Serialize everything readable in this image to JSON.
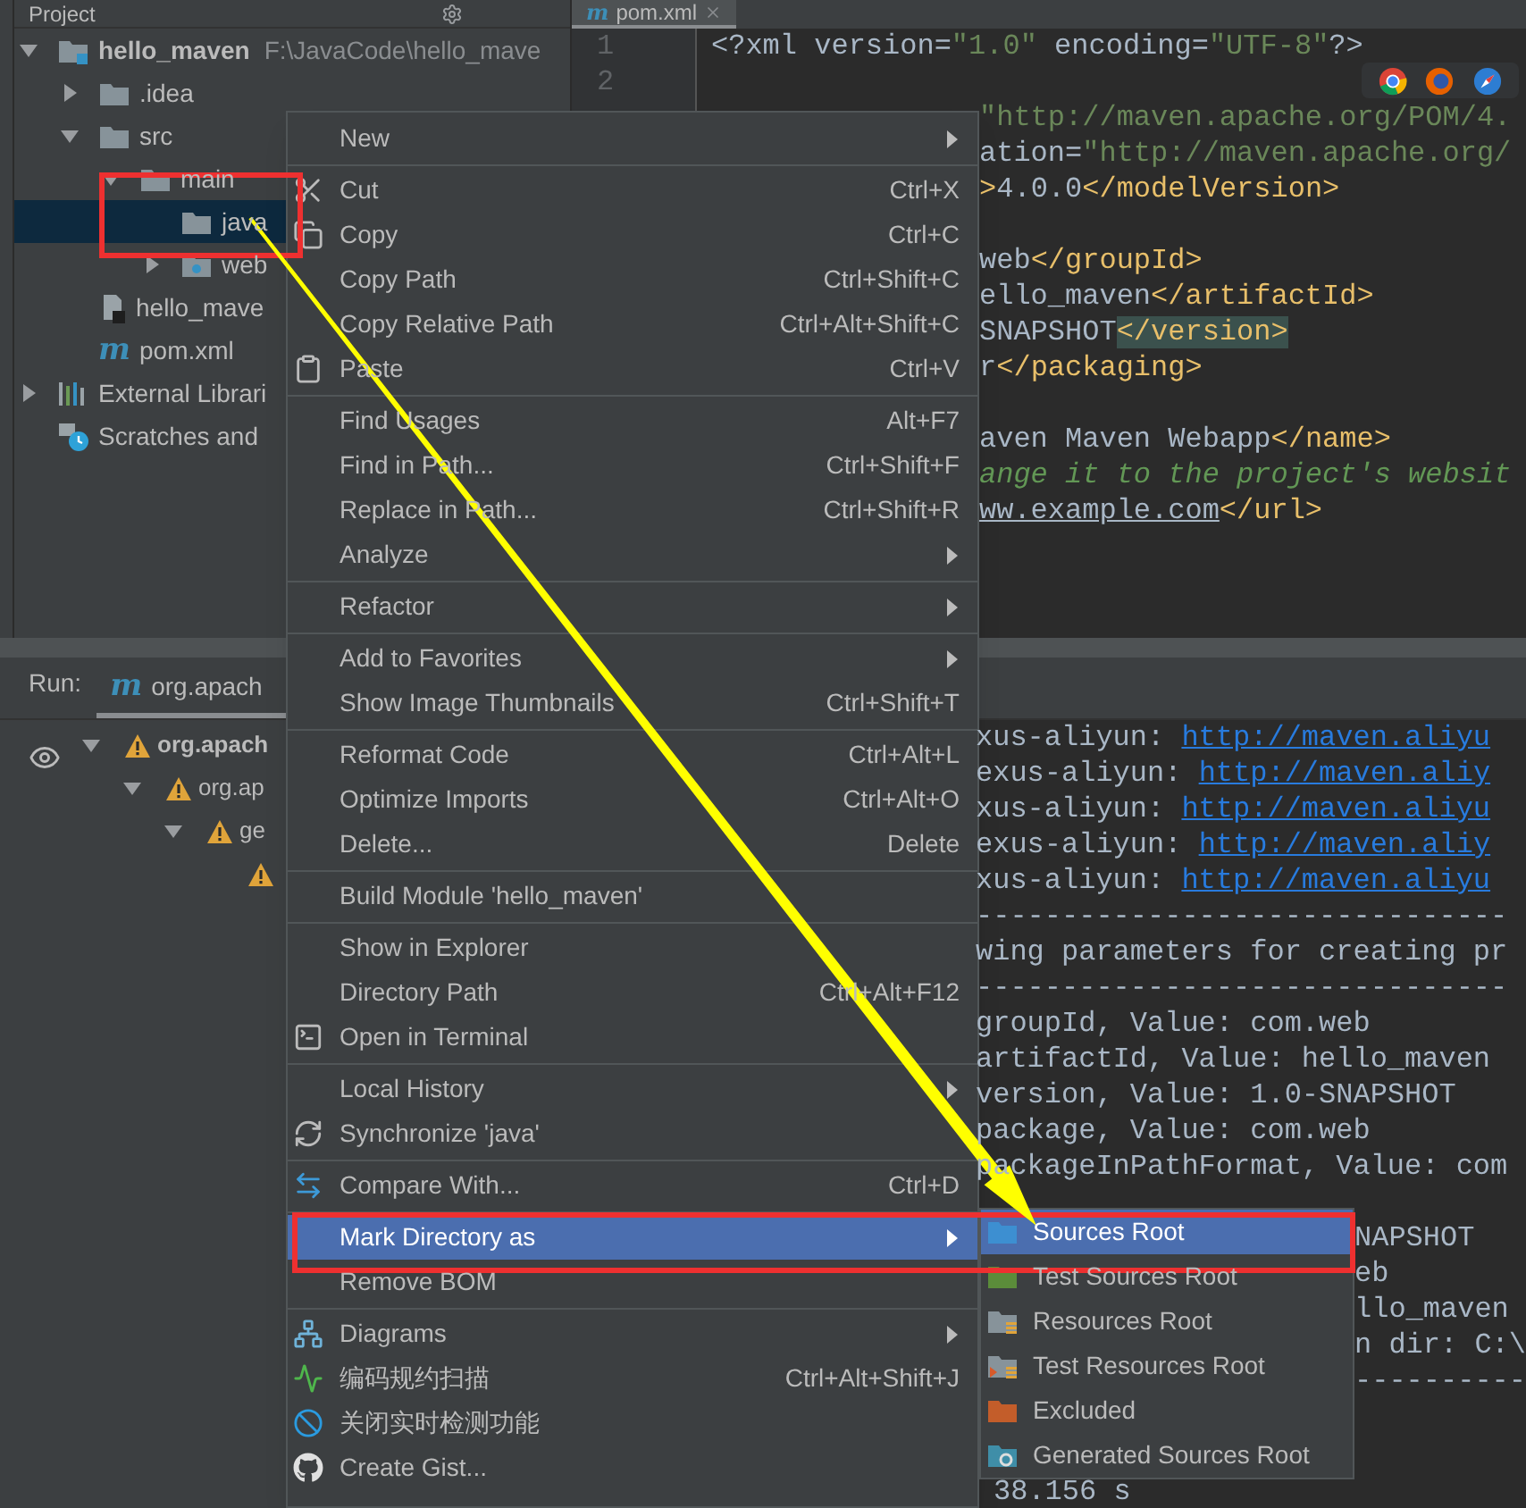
{
  "project_panel": {
    "title": "Project",
    "tree": [
      {
        "label": "hello_maven",
        "path": "F:\\JavaCode\\hello_mave",
        "kind": "module",
        "expanded": true,
        "selected": false,
        "children": [
          {
            "label": ".idea",
            "kind": "folder",
            "expanded": false,
            "selected": false
          },
          {
            "label": "src",
            "kind": "folder",
            "expanded": true,
            "selected": false,
            "children": [
              {
                "label": "main",
                "kind": "folder",
                "expanded": true,
                "selected": false,
                "children": [
                  {
                    "label": "java",
                    "kind": "folder",
                    "selected": true
                  },
                  {
                    "label": "web",
                    "kind": "web-folder",
                    "expanded": false,
                    "selected": false
                  }
                ]
              }
            ]
          },
          {
            "label": "hello_mave",
            "kind": "module-file",
            "selected": false
          },
          {
            "label": "pom.xml",
            "kind": "maven",
            "logo": "m",
            "selected": false
          }
        ]
      },
      {
        "label": "External Librari",
        "kind": "libraries",
        "expanded": false,
        "selected": false
      },
      {
        "label": "Scratches and",
        "kind": "scratches",
        "selected": false
      }
    ]
  },
  "editor": {
    "tab": {
      "label": "pom.xml",
      "logo": "m"
    },
    "line_numbers": [
      "1",
      "2"
    ],
    "blocks": [
      {
        "kind": "full",
        "lines": [
          [
            {
              "text": "<?xml version=",
              "kind": "text"
            },
            {
              "text": "\"1.0\"",
              "kind": "string"
            },
            {
              "text": " encoding=",
              "kind": "text"
            },
            {
              "text": "\"UTF-8\"",
              "kind": "string"
            },
            {
              "text": "?>",
              "kind": "text"
            }
          ]
        ]
      },
      {
        "kind": "partial",
        "lines": [
          [
            {
              "text": "\"http://maven.apache.org/POM/4.",
              "kind": "string"
            }
          ],
          [
            {
              "text": "ation=",
              "kind": "text"
            },
            {
              "text": "\"http://maven.apache.org/",
              "kind": "string"
            }
          ],
          [
            {
              "text": ">",
              "kind": "tag"
            },
            {
              "text": "4.0.0",
              "kind": "text"
            },
            {
              "text": "</modelVersion>",
              "kind": "tag"
            }
          ]
        ]
      },
      {
        "kind": "partial",
        "lines": [
          [
            {
              "text": "web",
              "kind": "text"
            },
            {
              "text": "</groupId>",
              "kind": "tag"
            }
          ],
          [
            {
              "text": "ello_maven",
              "kind": "text"
            },
            {
              "text": "</artifactId>",
              "kind": "tag"
            }
          ],
          [
            {
              "text": "SNAPSHOT",
              "kind": "text"
            },
            {
              "text": "</version>",
              "kind": "match"
            }
          ],
          [
            {
              "text": "r",
              "kind": "text"
            },
            {
              "text": "</packaging>",
              "kind": "tag"
            }
          ]
        ]
      },
      {
        "kind": "partial",
        "lines": [
          [
            {
              "text": "aven Maven Webapp",
              "kind": "text"
            },
            {
              "text": "</name>",
              "kind": "tag"
            }
          ],
          [
            {
              "text": "ange it to the project's websit",
              "kind": "comment"
            }
          ],
          [
            {
              "text": "ww.example.com",
              "kind": "url"
            },
            {
              "text": "</url>",
              "kind": "tag"
            }
          ]
        ]
      }
    ]
  },
  "run_panel": {
    "label": "Run:",
    "tab": {
      "label": "org.apach",
      "logo": "m",
      "selected": true
    },
    "tree": [
      {
        "label": "org.apach",
        "kind": "warning",
        "bold": true,
        "children": [
          {
            "label": "org.ap",
            "kind": "warning",
            "bold": false,
            "children": [
              {
                "label": "ge",
                "kind": "warning",
                "bold": false,
                "children": [
                  {
                    "kind": "warning"
                  }
                ]
              }
            ]
          }
        ]
      }
    ]
  },
  "console": {
    "lines": [
      [
        {
          "text": "xus-aliyun: ",
          "kind": "text"
        },
        {
          "text": "http://maven.aliyu",
          "kind": "link"
        }
      ],
      [
        {
          "text": "exus-aliyun: ",
          "kind": "text"
        },
        {
          "text": "http://maven.aliy",
          "kind": "link"
        }
      ],
      [
        {
          "text": "xus-aliyun: ",
          "kind": "text"
        },
        {
          "text": "http://maven.aliyu",
          "kind": "link"
        }
      ],
      [
        {
          "text": "exus-aliyun: ",
          "kind": "text"
        },
        {
          "text": "http://maven.aliy",
          "kind": "link"
        }
      ],
      [
        {
          "text": "xus-aliyun: ",
          "kind": "text"
        },
        {
          "text": "http://maven.aliyu",
          "kind": "link"
        }
      ],
      [
        {
          "text": "-------------------------------",
          "kind": "text"
        }
      ],
      [
        {
          "text": "wing parameters for creating pr",
          "kind": "text"
        }
      ],
      [
        {
          "text": "-------------------------------",
          "kind": "text"
        }
      ],
      [
        {
          "text": "groupId, Value: com.web",
          "kind": "text"
        }
      ],
      [
        {
          "text": "artifactId, Value: hello_maven",
          "kind": "text"
        }
      ],
      [
        {
          "text": "version, Value: 1.0-SNAPSHOT",
          "kind": "text"
        }
      ],
      [
        {
          "text": "package, Value: com.web",
          "kind": "text"
        }
      ],
      [
        {
          "text": "packageInPathFormat, Value: com",
          "kind": "text"
        }
      ]
    ],
    "side_lines": [
      "NAPSHOT",
      "eb",
      "llo_maven",
      "n dir: C:\\",
      "----------"
    ],
    "tail": "38.156 s"
  },
  "context_menu": {
    "groups": [
      [
        {
          "label": "New",
          "submenu": true,
          "selected": false
        }
      ],
      [
        {
          "label": "Cut",
          "shortcut": "Ctrl+X",
          "kind": "cut",
          "submenu": false,
          "selected": false
        },
        {
          "label": "Copy",
          "shortcut": "Ctrl+C",
          "kind": "copy",
          "submenu": false,
          "selected": false
        },
        {
          "label": "Copy Path",
          "shortcut": "Ctrl+Shift+C",
          "submenu": false,
          "selected": false
        },
        {
          "label": "Copy Relative Path",
          "shortcut": "Ctrl+Alt+Shift+C",
          "submenu": false,
          "selected": false
        },
        {
          "label": "Paste",
          "shortcut": "Ctrl+V",
          "kind": "paste",
          "submenu": false,
          "selected": false
        }
      ],
      [
        {
          "label": "Find Usages",
          "shortcut": "Alt+F7",
          "submenu": false,
          "selected": false
        },
        {
          "label": "Find in Path...",
          "shortcut": "Ctrl+Shift+F",
          "submenu": false,
          "selected": false
        },
        {
          "label": "Replace in Path...",
          "shortcut": "Ctrl+Shift+R",
          "submenu": false,
          "selected": false
        },
        {
          "label": "Analyze",
          "submenu": true,
          "selected": false
        }
      ],
      [
        {
          "label": "Refactor",
          "submenu": true,
          "selected": false
        }
      ],
      [
        {
          "label": "Add to Favorites",
          "submenu": true,
          "selected": false
        },
        {
          "label": "Show Image Thumbnails",
          "shortcut": "Ctrl+Shift+T",
          "submenu": false,
          "selected": false
        }
      ],
      [
        {
          "label": "Reformat Code",
          "shortcut": "Ctrl+Alt+L",
          "submenu": false,
          "selected": false
        },
        {
          "label": "Optimize Imports",
          "shortcut": "Ctrl+Alt+O",
          "submenu": false,
          "selected": false
        },
        {
          "label": "Delete...",
          "shortcut": "Delete",
          "submenu": false,
          "selected": false
        }
      ],
      [
        {
          "label": "Build Module 'hello_maven'",
          "submenu": false,
          "selected": false
        }
      ],
      [
        {
          "label": "Show in Explorer",
          "submenu": false,
          "selected": false
        },
        {
          "label": "Directory Path",
          "shortcut": "Ctrl+Alt+F12",
          "submenu": false,
          "selected": false
        },
        {
          "label": "Open in Terminal",
          "kind": "terminal",
          "submenu": false,
          "selected": false
        }
      ],
      [
        {
          "label": "Local History",
          "submenu": true,
          "selected": false
        },
        {
          "label": "Synchronize 'java'",
          "kind": "sync",
          "submenu": false,
          "selected": false
        }
      ],
      [
        {
          "label": "Compare With...",
          "shortcut": "Ctrl+D",
          "kind": "compare",
          "submenu": false,
          "selected": false
        }
      ],
      [
        {
          "label": "Mark Directory as",
          "submenu": true,
          "selected": true
        },
        {
          "label": "Remove BOM",
          "submenu": false,
          "selected": false
        }
      ],
      [
        {
          "label": "Diagrams",
          "kind": "diagrams",
          "submenu": true,
          "selected": false
        },
        {
          "label": "编码规约扫描",
          "shortcut": "Ctrl+Alt+Shift+J",
          "kind": "scan",
          "submenu": false,
          "selected": false
        },
        {
          "label": "关闭实时检测功能",
          "kind": "disable",
          "submenu": false,
          "selected": false
        },
        {
          "label": "Create Gist...",
          "kind": "github",
          "submenu": false,
          "selected": false
        }
      ]
    ]
  },
  "submenu": {
    "items": [
      {
        "label": "Sources Root",
        "kind": "sources",
        "selected": true
      },
      {
        "label": "Test Sources Root",
        "kind": "test-sources",
        "selected": false
      },
      {
        "label": "Resources Root",
        "kind": "resources",
        "selected": false
      },
      {
        "label": "Test Resources Root",
        "kind": "test-resources",
        "selected": false
      },
      {
        "label": "Excluded",
        "kind": "excluded",
        "selected": false
      },
      {
        "label": "Generated Sources Root",
        "kind": "generated",
        "selected": false
      }
    ]
  }
}
